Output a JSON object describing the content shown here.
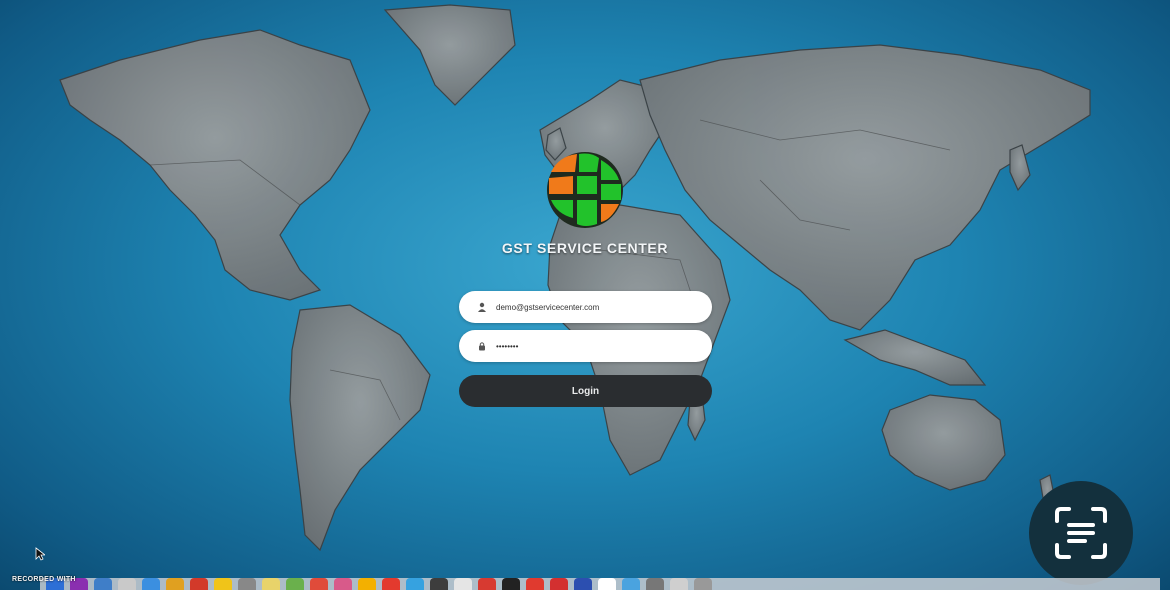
{
  "app": {
    "title": "GST SERVICE CENTER"
  },
  "login_form": {
    "email_value": "demo@gstservicecenter.com",
    "password_value": "••••••••",
    "login_label": "Login"
  },
  "icons": {
    "logo": "globe-logo-icon",
    "email": "user-icon",
    "password": "lock-icon",
    "scan": "text-scan-icon",
    "cursor": "mouse-pointer-icon"
  },
  "overlay": {
    "recorded_label": "RECORDED WITH"
  },
  "dock": {
    "apps": [
      "#2d6fd6",
      "#8a2fb0",
      "#3f7ec8",
      "#c9c9c9",
      "#3b8fe0",
      "#e0a020",
      "#d23a2a",
      "#f0c419",
      "#888888",
      "#e8d36a",
      "#6ab04c",
      "#e04b3a",
      "#d85a8a",
      "#f3b000",
      "#e33a2e",
      "#36a2e0",
      "#3d3d3d",
      "#e5e5e5",
      "#d73a31",
      "#222222",
      "#e03a2f",
      "#d33030",
      "#2c4fb0",
      "#ffffff",
      "#4aa3df",
      "#777777",
      "#cfcfcf",
      "#999999"
    ]
  },
  "colors": {
    "accent_green": "#22c22b",
    "accent_orange": "#f07a1a",
    "button_dark": "#2a2d30",
    "ocean": "#1e84b2"
  }
}
